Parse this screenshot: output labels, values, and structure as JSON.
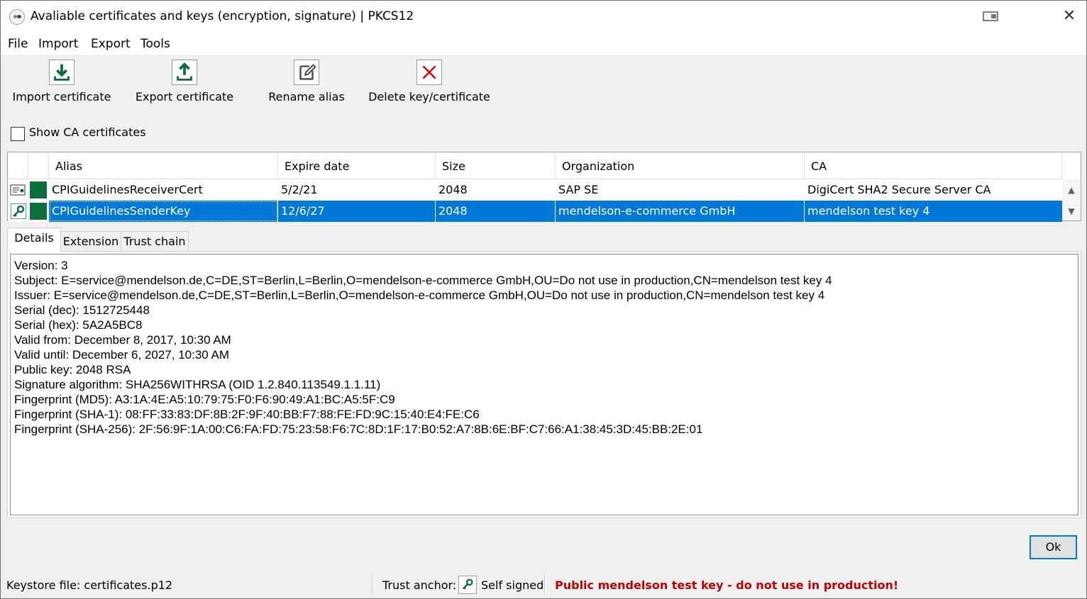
{
  "window": {
    "title": "Avaliable certificates and keys (encryption, signature) | PKCS12"
  },
  "menu": {
    "items": [
      "File",
      "Import",
      "Export",
      "Tools"
    ]
  },
  "toolbar": {
    "import_label": "Import certificate",
    "export_label": "Export certificate",
    "rename_label": "Rename alias",
    "delete_label": "Delete key/certificate"
  },
  "options": {
    "show_ca_label": "Show CA certificates",
    "show_ca_checked": false
  },
  "table": {
    "columns": [
      "Alias",
      "Expire date",
      "Size",
      "Organization",
      "CA"
    ],
    "rows": [
      {
        "icon": "certificate-icon",
        "alias": "CPIGuidelinesReceiverCert",
        "expire": "5/2/21",
        "size": "2048",
        "organization": "SAP SE",
        "ca": "DigiCert SHA2 Secure Server CA",
        "selected": false
      },
      {
        "icon": "key-icon",
        "alias": "CPIGuidelinesSenderKey",
        "expire": "12/6/27",
        "size": "2048",
        "organization": "mendelson-e-commerce GmbH",
        "ca": "mendelson test key 4",
        "selected": true
      }
    ]
  },
  "tabs": {
    "items": [
      "Details",
      "Extension",
      "Trust chain"
    ],
    "active": "Details"
  },
  "details": {
    "lines": [
      "Version: 3",
      "Subject: E=service@mendelson.de,C=DE,ST=Berlin,L=Berlin,O=mendelson-e-commerce GmbH,OU=Do not use in production,CN=mendelson test key 4",
      "Issuer: E=service@mendelson.de,C=DE,ST=Berlin,L=Berlin,O=mendelson-e-commerce GmbH,OU=Do not use in production,CN=mendelson test key 4",
      "Serial (dec): 1512725448",
      "Serial (hex): 5A2A5BC8",
      "Valid from: December 8, 2017, 10:30 AM",
      "Valid until: December 6, 2027, 10:30 AM",
      "Public key: 2048 RSA",
      "Signature algorithm: SHA256WITHRSA (OID 1.2.840.113549.1.1.11)",
      "Fingerprint (MD5): A3:1A:4E:A5:10:79:75:F0:F6:90:49:A1:BC:A5:5F:C9",
      "Fingerprint (SHA-1): 08:FF:33:83:DF:8B:2F:9F:40:BB:F7:88:FE:FD:9C:15:40:E4:FE:C6",
      "Fingerprint (SHA-256): 2F:56:9F:1A:00:C6:FA:FD:75:23:58:F6:7C:8D:1F:17:B0:52:A7:8B:6E:BF:C7:66:A1:38:45:3D:45:BB:2E:01"
    ]
  },
  "buttons": {
    "ok_label": "Ok"
  },
  "status": {
    "keystore": "Keystore file:  certificates.p12",
    "trust_anchor_label": "Trust anchor:",
    "trust_anchor_value": "Self signed",
    "warning": "Public mendelson test key - do not use in production!",
    "warning_color": "#c00000",
    "selection_color": "#0078d7",
    "accent_green": "#0b6e3a"
  }
}
